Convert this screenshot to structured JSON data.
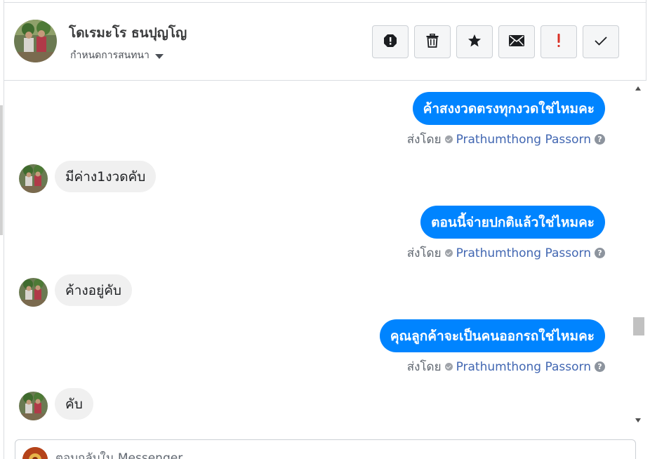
{
  "header": {
    "contact_name": "โดเรมะโร ธนปุญโญ",
    "conversation_settings_label": "กำหนดการสนทนา",
    "actions": [
      {
        "name": "report-icon"
      },
      {
        "name": "trash-icon"
      },
      {
        "name": "star-icon"
      },
      {
        "name": "envelope-icon"
      },
      {
        "name": "exclamation-icon"
      },
      {
        "name": "checkmark-icon"
      }
    ]
  },
  "thread": {
    "sent_by_label": "ส่งโดย",
    "messages": [
      {
        "direction": "outgoing",
        "text": "ค้าสงงวดตรงทุกงวดใช่ไหมคะ",
        "author": "Prathumthong Passorn"
      },
      {
        "direction": "incoming",
        "text": "มีค่าง1งวดคับ"
      },
      {
        "direction": "outgoing",
        "text": "ตอนนี้จ่ายปกติแล้วใช่ไหมคะ",
        "author": "Prathumthong Passorn"
      },
      {
        "direction": "incoming",
        "text": "ค้างอยู่คับ"
      },
      {
        "direction": "outgoing",
        "text": "คุณลูกค้าจะเป็นคนออกรถใช่ไหมคะ",
        "author": "Prathumthong Passorn"
      },
      {
        "direction": "incoming",
        "text": "คับ"
      }
    ]
  },
  "composer": {
    "placeholder": "ตอบกลับใน Messenger"
  },
  "colors": {
    "outgoing_bubble": "#0084ff",
    "incoming_bubble": "#f0f0f0",
    "author_link": "#4267b2",
    "exclamation_red": "#d93025"
  }
}
